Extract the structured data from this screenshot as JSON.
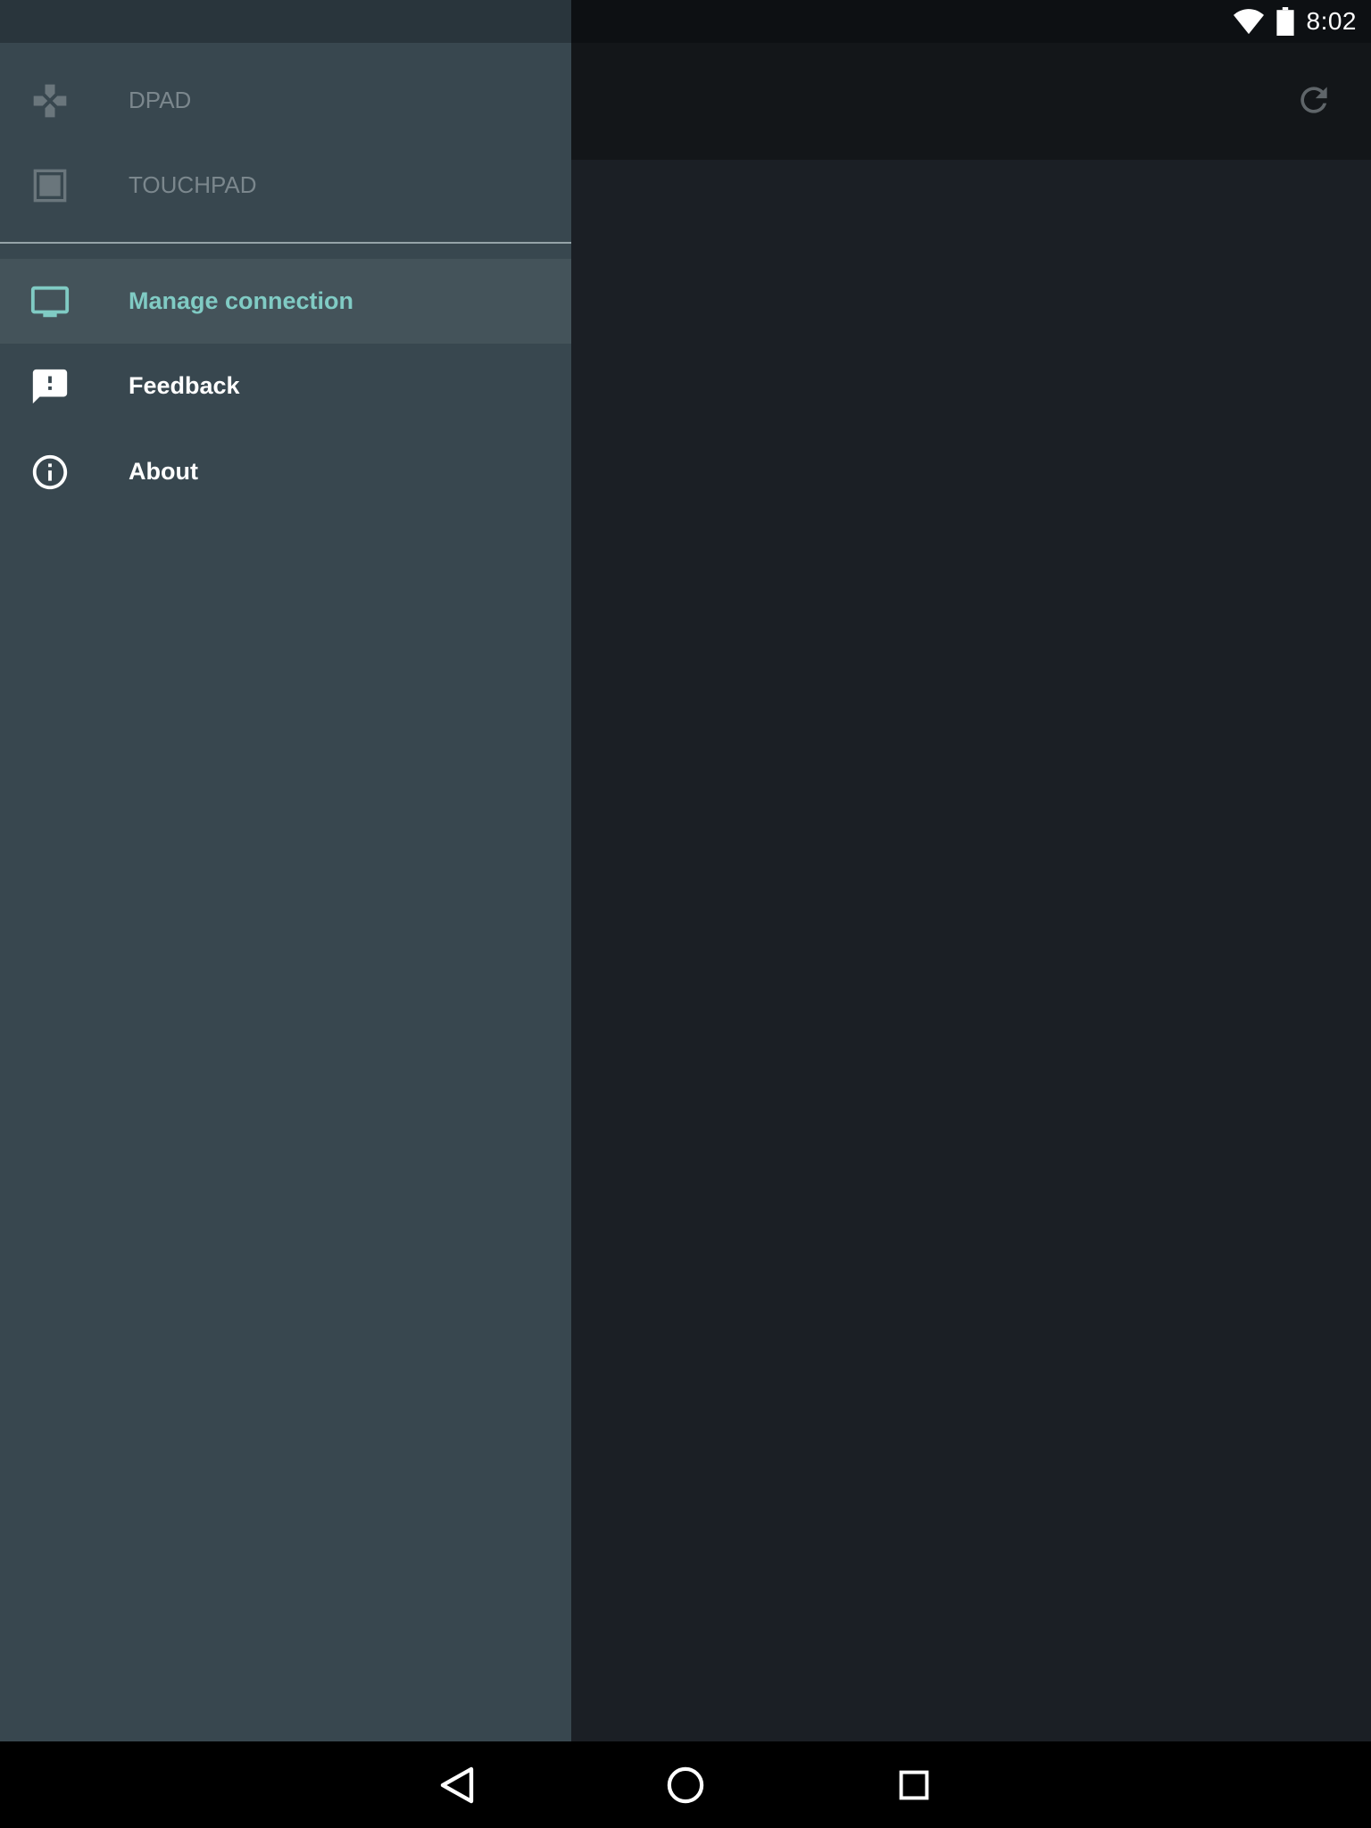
{
  "status_bar": {
    "time": "8:02",
    "icons": [
      "wifi-icon",
      "battery-icon"
    ]
  },
  "app_bar": {
    "action_icon": "refresh-icon"
  },
  "drawer": {
    "modes": [
      {
        "label": "DPAD",
        "icon": "gamepad-icon"
      },
      {
        "label": "TOUCHPAD",
        "icon": "touchpad-icon"
      }
    ],
    "items": [
      {
        "label": "Manage connection",
        "icon": "tv-icon",
        "selected": true
      },
      {
        "label": "Feedback",
        "icon": "feedback-icon",
        "selected": false
      },
      {
        "label": "About",
        "icon": "info-icon",
        "selected": false
      }
    ]
  },
  "nav_bar": {
    "buttons": [
      "back-icon",
      "home-icon",
      "recents-icon"
    ]
  },
  "colors": {
    "drawer_bg": "#38474f",
    "accent": "#80cbc4",
    "mode_text": "#7b878d",
    "main_bg": "#1b1f25"
  }
}
